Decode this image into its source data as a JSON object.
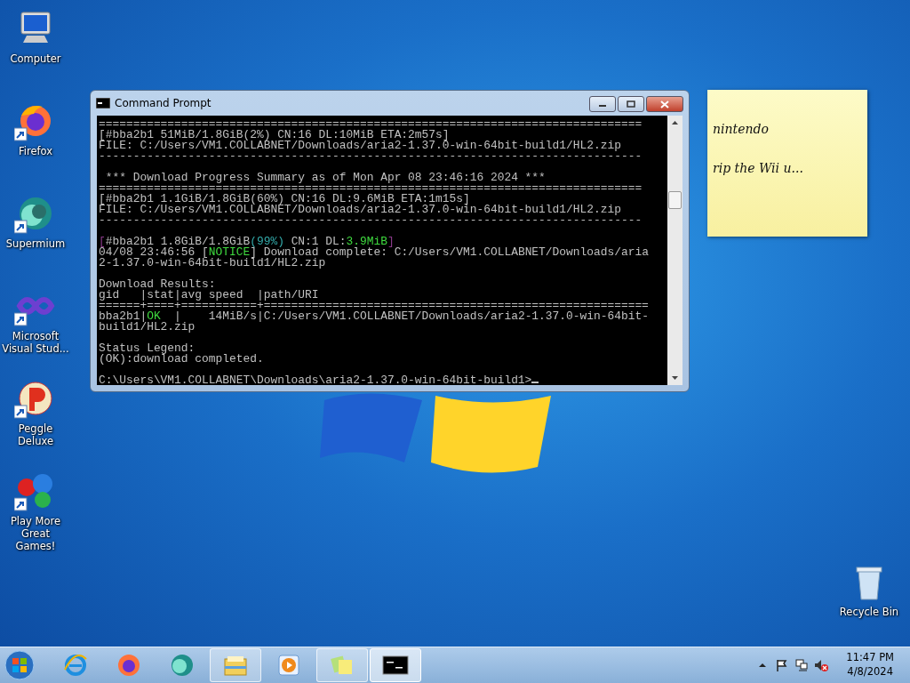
{
  "desktop_icons": [
    {
      "label": "Computer",
      "kind": "computer",
      "shortcut": false
    },
    {
      "label": "Firefox",
      "kind": "firefox",
      "shortcut": true
    },
    {
      "label": "Supermium",
      "kind": "supermium",
      "shortcut": true
    },
    {
      "label": "Microsoft Visual Stud...",
      "kind": "vstudio",
      "shortcut": true
    },
    {
      "label": "Peggle Deluxe",
      "kind": "peggle",
      "shortcut": true
    },
    {
      "label": "Play More Great Games!",
      "kind": "games",
      "shortcut": true
    }
  ],
  "recycle_bin": {
    "label": "Recycle Bin"
  },
  "window": {
    "title": "Command Prompt",
    "lines": [
      {
        "segments": [
          {
            "text": "===============================================================================",
            "kind": "plain"
          }
        ]
      },
      {
        "segments": [
          {
            "text": "[#bba2b1 51MiB/1.8GiB(2%) CN:16 DL:10MiB ETA:2m57s]",
            "kind": "plain"
          }
        ]
      },
      {
        "segments": [
          {
            "text": "FILE: C:/Users/VM1.COLLABNET/Downloads/aria2-1.37.0-win-64bit-build1/HL2.zip",
            "kind": "plain"
          }
        ]
      },
      {
        "segments": [
          {
            "text": "-------------------------------------------------------------------------------",
            "kind": "plain"
          }
        ]
      },
      {
        "kind": "blank"
      },
      {
        "segments": [
          {
            "text": " *** Download Progress Summary as of Mon Apr 08 23:46:16 2024 ***",
            "kind": "plain"
          }
        ]
      },
      {
        "segments": [
          {
            "text": "===============================================================================",
            "kind": "plain"
          }
        ]
      },
      {
        "segments": [
          {
            "text": "[#bba2b1 1.1GiB/1.8GiB(60%) CN:16 DL:9.6MiB ETA:1m15s]",
            "kind": "plain"
          }
        ]
      },
      {
        "segments": [
          {
            "text": "FILE: C:/Users/VM1.COLLABNET/Downloads/aria2-1.37.0-win-64bit-build1/HL2.zip",
            "kind": "plain"
          }
        ]
      },
      {
        "segments": [
          {
            "text": "-------------------------------------------------------------------------------",
            "kind": "plain"
          }
        ]
      },
      {
        "kind": "blank"
      },
      {
        "segments": [
          {
            "text": "[",
            "kind": "dim"
          },
          {
            "text": "#bba2b1 1.8GiB/1.8GiB",
            "kind": "plain"
          },
          {
            "text": "(99%)",
            "kind": "cyan"
          },
          {
            "text": " CN:1 DL:",
            "kind": "plain"
          },
          {
            "text": "3.9MiB",
            "kind": "green"
          },
          {
            "text": "]",
            "kind": "dim"
          }
        ]
      },
      {
        "segments": [
          {
            "text": "04/08 23:46:56 [",
            "kind": "plain"
          },
          {
            "text": "NOTICE",
            "kind": "green"
          },
          {
            "text": "] Download complete: C:/Users/VM1.COLLABNET/Downloads/aria",
            "kind": "plain"
          }
        ]
      },
      {
        "segments": [
          {
            "text": "2-1.37.0-win-64bit-build1/HL2.zip",
            "kind": "plain"
          }
        ]
      },
      {
        "kind": "blank"
      },
      {
        "segments": [
          {
            "text": "Download Results:",
            "kind": "plain"
          }
        ]
      },
      {
        "segments": [
          {
            "text": "gid   |stat|avg speed  |path/URI",
            "kind": "plain"
          }
        ]
      },
      {
        "segments": [
          {
            "text": "======+====+===========+========================================================",
            "kind": "plain"
          }
        ]
      },
      {
        "segments": [
          {
            "text": "bba2b1|",
            "kind": "plain"
          },
          {
            "text": "OK",
            "kind": "green"
          },
          {
            "text": "  |    14MiB/s|C:/Users/VM1.COLLABNET/Downloads/aria2-1.37.0-win-64bit-",
            "kind": "plain"
          }
        ]
      },
      {
        "segments": [
          {
            "text": "build1/HL2.zip",
            "kind": "plain"
          }
        ]
      },
      {
        "kind": "blank"
      },
      {
        "segments": [
          {
            "text": "Status Legend:",
            "kind": "plain"
          }
        ]
      },
      {
        "segments": [
          {
            "text": "(OK):download completed.",
            "kind": "plain"
          }
        ]
      },
      {
        "kind": "blank"
      },
      {
        "segments": [
          {
            "text": "C:\\Users\\VM1.COLLABNET\\Downloads\\aria2-1.37.0-win-64bit-build1>",
            "kind": "plain"
          }
        ],
        "cursor": true
      }
    ]
  },
  "sticky_note": {
    "lines": [
      "nintendo",
      "rip the Wii u..."
    ]
  },
  "taskbar": {
    "items": [
      {
        "kind": "ie",
        "running": false
      },
      {
        "kind": "firefox",
        "running": false
      },
      {
        "kind": "supermium",
        "running": false
      },
      {
        "kind": "explorer",
        "running": true
      },
      {
        "kind": "media",
        "running": false
      },
      {
        "kind": "sticky",
        "running": true
      },
      {
        "kind": "cmd",
        "running": true,
        "selected": true
      }
    ],
    "clock": {
      "time": "11:47 PM",
      "date": "4/8/2024"
    }
  }
}
